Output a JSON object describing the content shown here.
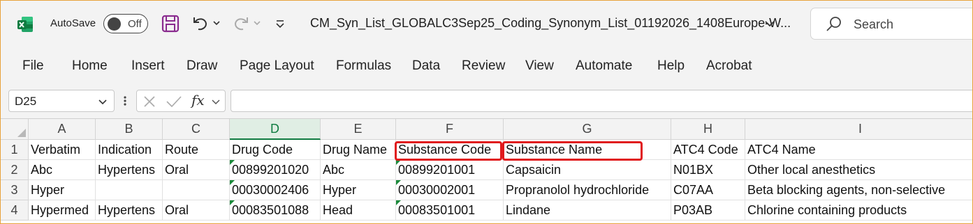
{
  "titlebar": {
    "autosave_label": "AutoSave",
    "autosave_state": "Off",
    "document_title": "CM_Syn_List_GLOBALC3Sep25_Coding_Synonym_List_01192026_1408Europe-W...",
    "search_placeholder": "Search",
    "icons": [
      "excel-logo-icon",
      "save-icon",
      "undo-icon",
      "redo-icon",
      "customize-qat-icon",
      "chevron-down-icon",
      "search-icon"
    ]
  },
  "ribbon": {
    "tabs": [
      "File",
      "Home",
      "Insert",
      "Draw",
      "Page Layout",
      "Formulas",
      "Data",
      "Review",
      "View",
      "Automate",
      "Help",
      "Acrobat"
    ]
  },
  "formula_bar": {
    "name_box": "D25",
    "fx_label": "fx",
    "formula": ""
  },
  "sheet": {
    "selected_column": "D",
    "columns": [
      "A",
      "B",
      "C",
      "D",
      "E",
      "F",
      "G",
      "H",
      "I"
    ],
    "rows": [
      {
        "num": "1",
        "cells": [
          "Verbatim",
          "Indication",
          "Route",
          "Drug Code",
          "Drug Name",
          "Substance Code",
          "Substance Name",
          "ATC4 Code",
          "ATC4 Name"
        ]
      },
      {
        "num": "2",
        "cells": [
          "Abc",
          "Hypertens",
          "Oral",
          "00899201020",
          "Abc",
          "00899201001",
          "Capsaicin",
          "N01BX",
          "Other local anesthetics"
        ]
      },
      {
        "num": "3",
        "cells": [
          "Hyper",
          "",
          "",
          "00030002406",
          "Hyper",
          "00030002001",
          "Propranolol hydrochloride",
          "C07AA",
          "Beta blocking agents, non-selective"
        ]
      },
      {
        "num": "4",
        "cells": [
          "Hypermed",
          "Hypertens",
          "Oral",
          "00083501088",
          "Head",
          "00083501001",
          "Lindane",
          "P03AB",
          "Chlorine containing products"
        ]
      }
    ],
    "highlighted_headers": [
      "Substance Code",
      "Substance Name"
    ],
    "highlight_color": "#e0191c",
    "accent_color": "#107c41"
  }
}
